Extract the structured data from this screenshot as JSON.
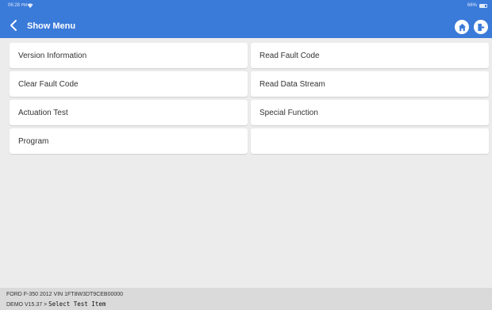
{
  "status_bar": {
    "time": "06:28",
    "period": "PM",
    "battery": "66%"
  },
  "header": {
    "title": "Show Menu"
  },
  "menu": {
    "items": [
      {
        "label": "Version Information"
      },
      {
        "label": "Read Fault Code"
      },
      {
        "label": "Clear Fault Code"
      },
      {
        "label": "Read Data Stream"
      },
      {
        "label": "Actuation Test"
      },
      {
        "label": "Special Function"
      },
      {
        "label": "Program"
      },
      {
        "label": ""
      }
    ]
  },
  "footer": {
    "vehicle_info": "FORD  F-350  2012  VIN  1FT8W3DT9CEB00000",
    "version": "DEMO V15.37 >",
    "current_step": "Select Test Item"
  },
  "colors": {
    "header_blue": "#3a7ad9",
    "background": "#ececec",
    "footer": "#dadada"
  }
}
